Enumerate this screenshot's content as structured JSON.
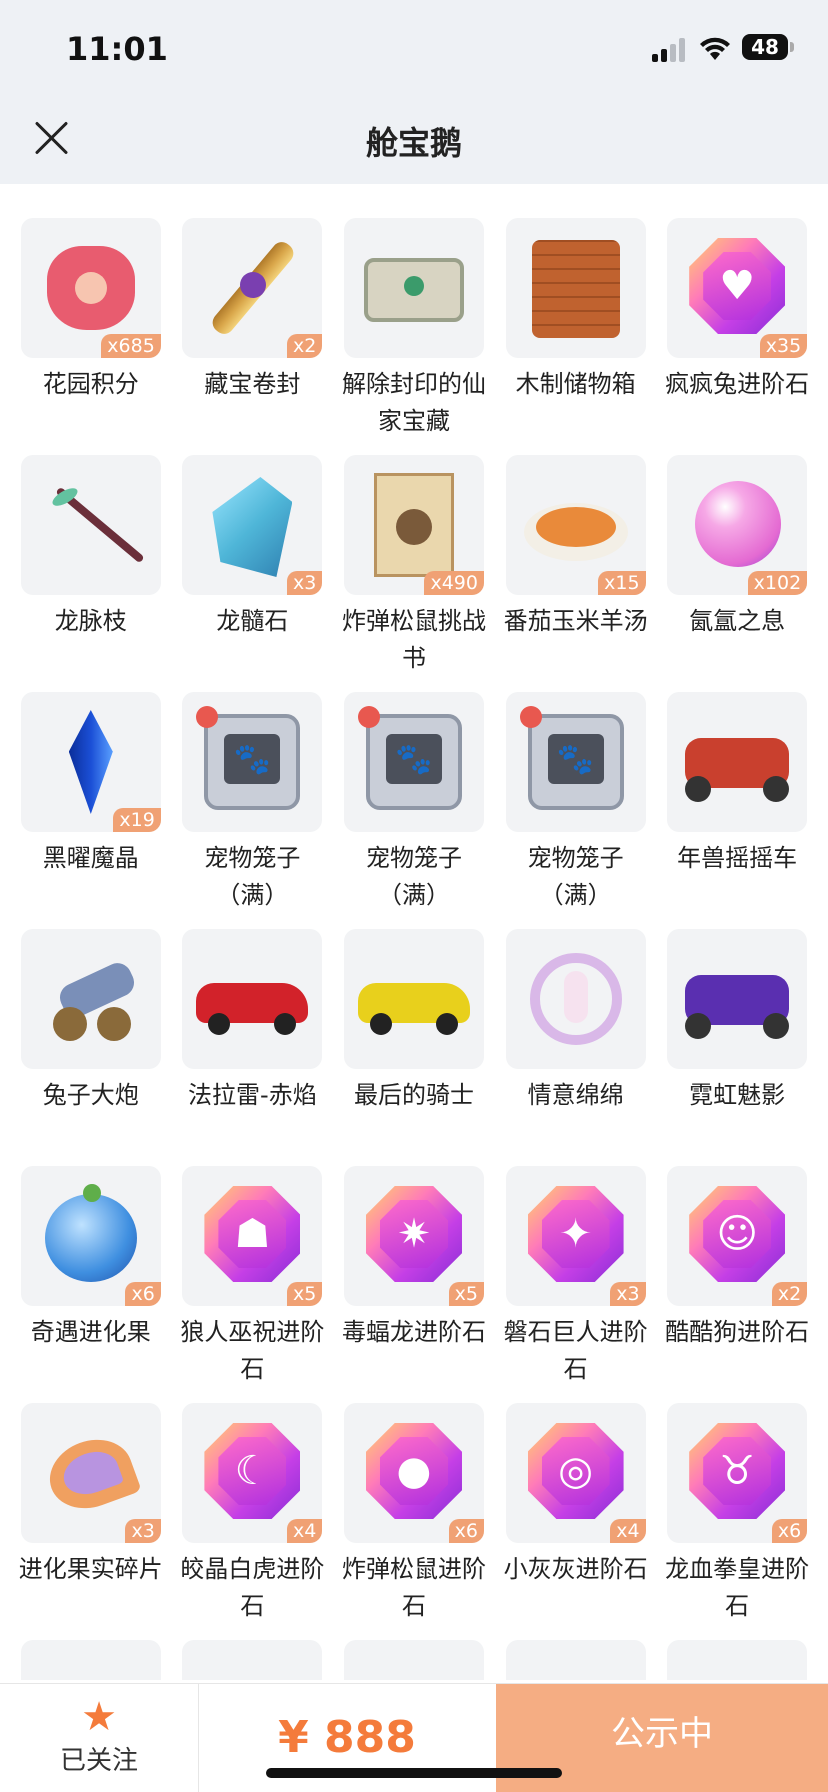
{
  "status_bar": {
    "time": "11:01",
    "battery": "48"
  },
  "nav": {
    "title": "舱宝鹅"
  },
  "items": [
    {
      "name": "花园积分",
      "count": "x685",
      "icon": "flower-icon",
      "color": "#e85c6f"
    },
    {
      "name": "藏宝卷封",
      "count": "x2",
      "icon": "scroll-icon",
      "color": "#d9a64a"
    },
    {
      "name": "解除封印的仙家宝藏",
      "count": "",
      "icon": "chest-icon",
      "color": "#9aa08a"
    },
    {
      "name": "木制储物箱",
      "count": "",
      "icon": "wooden-box-icon",
      "color": "#c0622f"
    },
    {
      "name": "疯疯兔进阶石",
      "count": "x35",
      "icon": "gem-icon",
      "color": "#c53fe6",
      "symbol": "♥"
    },
    {
      "name": "龙脉枝",
      "count": "",
      "icon": "branch-icon",
      "color": "#6b2f3a"
    },
    {
      "name": "龙髓石",
      "count": "x3",
      "icon": "crystal-icon",
      "color": "#4fb6d8"
    },
    {
      "name": "炸弹松鼠挑战书",
      "count": "x490",
      "icon": "wanted-poster-icon",
      "color": "#b99360"
    },
    {
      "name": "番茄玉米羊汤",
      "count": "x15",
      "icon": "soup-icon",
      "color": "#e98a3a"
    },
    {
      "name": "氤氲之息",
      "count": "x102",
      "icon": "orb-icon",
      "color": "#e46ad2"
    },
    {
      "name": "黑曜魔晶",
      "count": "x19",
      "icon": "obsidian-crystal-icon",
      "color": "#1b4fd6"
    },
    {
      "name": "宠物笼子（满）",
      "count": "",
      "icon": "pet-cage-icon",
      "color": "#8f97a6"
    },
    {
      "name": "宠物笼子（满）",
      "count": "",
      "icon": "pet-cage-icon",
      "color": "#8f97a6"
    },
    {
      "name": "宠物笼子（满）",
      "count": "",
      "icon": "pet-cage-icon",
      "color": "#8f97a6"
    },
    {
      "name": "年兽摇摇车",
      "count": "",
      "icon": "kart-icon",
      "color": "#c9402e"
    },
    {
      "name": "兔子大炮",
      "count": "",
      "icon": "cannon-icon",
      "color": "#7a8fb8"
    },
    {
      "name": "法拉雷-赤焰",
      "count": "",
      "icon": "red-car-icon",
      "color": "#d2222a"
    },
    {
      "name": "最后的骑士",
      "count": "",
      "icon": "yellow-car-icon",
      "color": "#e8d01c"
    },
    {
      "name": "情意绵绵",
      "count": "",
      "icon": "wreath-icon",
      "color": "#d9b8e8"
    },
    {
      "name": "霓虹魅影",
      "count": "",
      "icon": "neon-kart-icon",
      "color": "#5a2fb0"
    },
    {
      "name": "奇遇进化果",
      "count": "x6",
      "icon": "blue-fruit-icon",
      "color": "#3f8fe0"
    },
    {
      "name": "狼人巫祝进阶石",
      "count": "x5",
      "icon": "gem-icon",
      "color": "#c53fe6",
      "symbol": "☗"
    },
    {
      "name": "毒蝠龙进阶石",
      "count": "x5",
      "icon": "gem-icon",
      "color": "#c53fe6",
      "symbol": "✷"
    },
    {
      "name": "磐石巨人进阶石",
      "count": "x3",
      "icon": "gem-icon",
      "color": "#c53fe6",
      "symbol": "✦"
    },
    {
      "name": "酷酷狗进阶石",
      "count": "x2",
      "icon": "gem-icon",
      "color": "#c53fe6",
      "symbol": "☺"
    },
    {
      "name": "进化果实碎片",
      "count": "x3",
      "icon": "fruit-slice-icon",
      "color": "#f0a060"
    },
    {
      "name": "皎晶白虎进阶石",
      "count": "x4",
      "icon": "gem-icon",
      "color": "#c53fe6",
      "symbol": "☾"
    },
    {
      "name": "炸弹松鼠进阶石",
      "count": "x6",
      "icon": "gem-icon",
      "color": "#c53fe6",
      "symbol": "●"
    },
    {
      "name": "小灰灰进阶石",
      "count": "x4",
      "icon": "gem-icon",
      "color": "#c53fe6",
      "symbol": "◎"
    },
    {
      "name": "龙血拳皇进阶石",
      "count": "x6",
      "icon": "gem-icon",
      "color": "#c53fe6",
      "symbol": "♉"
    }
  ],
  "bottom_bar": {
    "follow_label": "已关注",
    "price": "¥ 888",
    "status_button": "公示中",
    "accent_color": "#f47b3b"
  }
}
